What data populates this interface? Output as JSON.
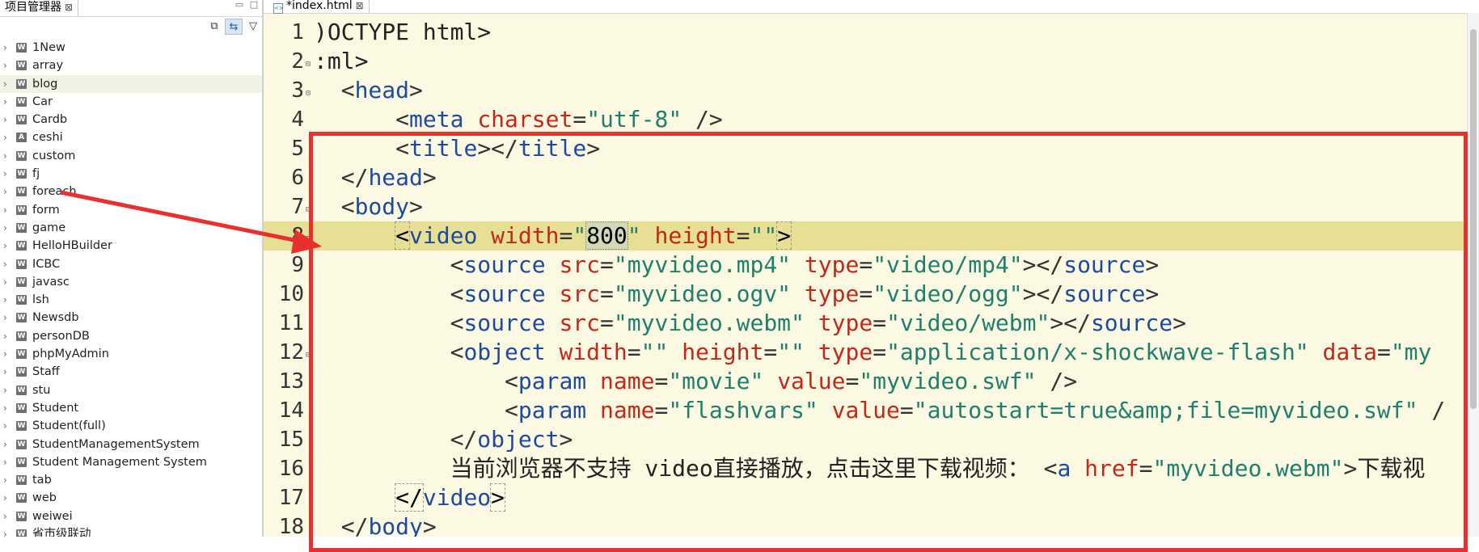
{
  "explorer": {
    "tab_label": "项目管理器",
    "tab_close": "⊠",
    "minimize": "▭",
    "maximize": "□",
    "toolbar": {
      "collapse_icon": "collapse-all-icon",
      "link_icon": "link-with-editor-icon",
      "menu_icon": "view-menu-icon"
    },
    "projects": [
      {
        "name": "1New",
        "icon": "W"
      },
      {
        "name": "array",
        "icon": "W"
      },
      {
        "name": "blog",
        "icon": "W",
        "selected": true
      },
      {
        "name": "Car",
        "icon": "W"
      },
      {
        "name": "Cardb",
        "icon": "W"
      },
      {
        "name": "ceshi",
        "icon": "A"
      },
      {
        "name": "custom",
        "icon": "W"
      },
      {
        "name": "fj",
        "icon": "W"
      },
      {
        "name": "foreach",
        "icon": "W"
      },
      {
        "name": "form",
        "icon": "W"
      },
      {
        "name": "game",
        "icon": "W"
      },
      {
        "name": "HelloHBuilder",
        "icon": "W"
      },
      {
        "name": "ICBC",
        "icon": "W"
      },
      {
        "name": "javasc",
        "icon": "W"
      },
      {
        "name": "lsh",
        "icon": "W"
      },
      {
        "name": "Newsdb",
        "icon": "W"
      },
      {
        "name": "personDB",
        "icon": "W"
      },
      {
        "name": "phpMyAdmin",
        "icon": "W"
      },
      {
        "name": "Staff",
        "icon": "W"
      },
      {
        "name": "stu",
        "icon": "W"
      },
      {
        "name": "Student",
        "icon": "W"
      },
      {
        "name": "Student(full)",
        "icon": "W"
      },
      {
        "name": "StudentManagementSystem",
        "icon": "W"
      },
      {
        "name": "Student Management System",
        "icon": "W"
      },
      {
        "name": "tab",
        "icon": "W"
      },
      {
        "name": "web",
        "icon": "W"
      },
      {
        "name": "weiwei",
        "icon": "W"
      },
      {
        "name": "省市级联动",
        "icon": "W"
      }
    ]
  },
  "editor": {
    "tab_label": "*index.html",
    "tab_close": "⊠",
    "highlight_line": 8,
    "lines": [
      {
        "n": "1",
        "fold": "",
        "tokens": [
          [
            "p",
            ")OCTYPE html>"
          ]
        ]
      },
      {
        "n": "2",
        "fold": "⊟",
        "tokens": [
          [
            "p",
            ":ml>"
          ]
        ]
      },
      {
        "n": "3",
        "fold": "⊟",
        "tokens": [
          [
            "b",
            "  <"
          ],
          [
            "t",
            "head"
          ],
          [
            "b",
            ">"
          ]
        ]
      },
      {
        "n": "4",
        "fold": "",
        "tokens": [
          [
            "b",
            "      <"
          ],
          [
            "t",
            "meta"
          ],
          [
            "b",
            " "
          ],
          [
            "a",
            "charset"
          ],
          [
            "b",
            "="
          ],
          [
            "s",
            "\"utf-8\""
          ],
          [
            "b",
            " />"
          ]
        ]
      },
      {
        "n": "5",
        "fold": "",
        "tokens": [
          [
            "b",
            "      <"
          ],
          [
            "t",
            "title"
          ],
          [
            "b",
            "></"
          ],
          [
            "t",
            "title"
          ],
          [
            "b",
            ">"
          ]
        ]
      },
      {
        "n": "6",
        "fold": "",
        "tokens": [
          [
            "b",
            "  </"
          ],
          [
            "t",
            "head"
          ],
          [
            "b",
            ">"
          ]
        ]
      },
      {
        "n": "7",
        "fold": "⊟",
        "tokens": [
          [
            "b",
            "  <"
          ],
          [
            "t",
            "body"
          ],
          [
            "b",
            ">"
          ]
        ]
      },
      {
        "n": "8",
        "fold": "⊟",
        "tokens": [
          [
            "b",
            "      "
          ],
          [
            "box",
            "<"
          ],
          [
            "t",
            "video"
          ],
          [
            "b",
            " "
          ],
          [
            "a",
            "width"
          ],
          [
            "b",
            "="
          ],
          [
            "s",
            "\""
          ],
          [
            "sel",
            "800"
          ],
          [
            "s",
            "\""
          ],
          [
            "b",
            " "
          ],
          [
            "a",
            "height"
          ],
          [
            "b",
            "="
          ],
          [
            "s",
            "\"\""
          ],
          [
            "box",
            ">"
          ]
        ]
      },
      {
        "n": "9",
        "fold": "",
        "tokens": [
          [
            "b",
            "          <"
          ],
          [
            "t",
            "source"
          ],
          [
            "b",
            " "
          ],
          [
            "a",
            "src"
          ],
          [
            "b",
            "="
          ],
          [
            "s",
            "\"myvideo.mp4\""
          ],
          [
            "b",
            " "
          ],
          [
            "a",
            "type"
          ],
          [
            "b",
            "="
          ],
          [
            "s",
            "\"video/mp4\""
          ],
          [
            "b",
            "></"
          ],
          [
            "t",
            "source"
          ],
          [
            "b",
            ">"
          ]
        ]
      },
      {
        "n": "10",
        "fold": "",
        "tokens": [
          [
            "b",
            "          <"
          ],
          [
            "t",
            "source"
          ],
          [
            "b",
            " "
          ],
          [
            "a",
            "src"
          ],
          [
            "b",
            "="
          ],
          [
            "s",
            "\"myvideo.ogv\""
          ],
          [
            "b",
            " "
          ],
          [
            "a",
            "type"
          ],
          [
            "b",
            "="
          ],
          [
            "s",
            "\"video/ogg\""
          ],
          [
            "b",
            "></"
          ],
          [
            "t",
            "source"
          ],
          [
            "b",
            ">"
          ]
        ]
      },
      {
        "n": "11",
        "fold": "",
        "tokens": [
          [
            "b",
            "          <"
          ],
          [
            "t",
            "source"
          ],
          [
            "b",
            " "
          ],
          [
            "a",
            "src"
          ],
          [
            "b",
            "="
          ],
          [
            "s",
            "\"myvideo.webm\""
          ],
          [
            "b",
            " "
          ],
          [
            "a",
            "type"
          ],
          [
            "b",
            "="
          ],
          [
            "s",
            "\"video/webm\""
          ],
          [
            "b",
            "></"
          ],
          [
            "t",
            "source"
          ],
          [
            "b",
            ">"
          ]
        ]
      },
      {
        "n": "12",
        "fold": "⊟",
        "tokens": [
          [
            "b",
            "          <"
          ],
          [
            "t",
            "object"
          ],
          [
            "b",
            " "
          ],
          [
            "a",
            "width"
          ],
          [
            "b",
            "="
          ],
          [
            "s",
            "\"\""
          ],
          [
            "b",
            " "
          ],
          [
            "a",
            "height"
          ],
          [
            "b",
            "="
          ],
          [
            "s",
            "\"\""
          ],
          [
            "b",
            " "
          ],
          [
            "a",
            "type"
          ],
          [
            "b",
            "="
          ],
          [
            "s",
            "\"application/x-shockwave-flash\""
          ],
          [
            "b",
            " "
          ],
          [
            "a",
            "data"
          ],
          [
            "b",
            "="
          ],
          [
            "s",
            "\"my"
          ]
        ]
      },
      {
        "n": "13",
        "fold": "",
        "tokens": [
          [
            "b",
            "              <"
          ],
          [
            "t",
            "param"
          ],
          [
            "b",
            " "
          ],
          [
            "a",
            "name"
          ],
          [
            "b",
            "="
          ],
          [
            "s",
            "\"movie\""
          ],
          [
            "b",
            " "
          ],
          [
            "a",
            "value"
          ],
          [
            "b",
            "="
          ],
          [
            "s",
            "\"myvideo.swf\""
          ],
          [
            "b",
            " />"
          ]
        ]
      },
      {
        "n": "14",
        "fold": "",
        "tokens": [
          [
            "b",
            "              <"
          ],
          [
            "t",
            "param"
          ],
          [
            "b",
            " "
          ],
          [
            "a",
            "name"
          ],
          [
            "b",
            "="
          ],
          [
            "s",
            "\"flashvars\""
          ],
          [
            "b",
            " "
          ],
          [
            "a",
            "value"
          ],
          [
            "b",
            "="
          ],
          [
            "s",
            "\"autostart=true&amp;file=myvideo.swf\""
          ],
          [
            "b",
            " /"
          ]
        ]
      },
      {
        "n": "15",
        "fold": "",
        "tokens": [
          [
            "b",
            "          </"
          ],
          [
            "t",
            "object"
          ],
          [
            "b",
            ">"
          ]
        ]
      },
      {
        "n": "16",
        "fold": "",
        "tokens": [
          [
            "p",
            "          当前浏览器不支持 video直接播放，点击这里下载视频： "
          ],
          [
            "b",
            "<"
          ],
          [
            "t",
            "a"
          ],
          [
            "b",
            " "
          ],
          [
            "a",
            "href"
          ],
          [
            "b",
            "="
          ],
          [
            "s",
            "\"myvideo.webm\""
          ],
          [
            "b",
            ">"
          ],
          [
            "p",
            "下载视"
          ]
        ]
      },
      {
        "n": "17",
        "fold": "",
        "tokens": [
          [
            "b",
            "      "
          ],
          [
            "box",
            "</"
          ],
          [
            "t",
            "video"
          ],
          [
            "box",
            ">"
          ]
        ]
      },
      {
        "n": "18",
        "fold": "",
        "tokens": [
          [
            "b",
            "  </"
          ],
          [
            "t",
            "body"
          ],
          [
            "b",
            ">"
          ]
        ]
      }
    ]
  },
  "annotation": {
    "box_color": "#e8302f",
    "arrow_color": "#e8302f"
  }
}
